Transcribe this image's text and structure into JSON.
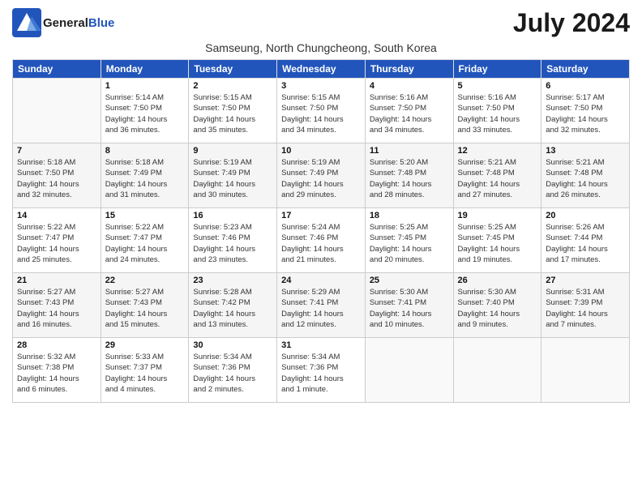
{
  "logo": {
    "general": "General",
    "blue": "Blue"
  },
  "title": "July 2024",
  "subtitle": "Samseung, North Chungcheong, South Korea",
  "days_of_week": [
    "Sunday",
    "Monday",
    "Tuesday",
    "Wednesday",
    "Thursday",
    "Friday",
    "Saturday"
  ],
  "weeks": [
    [
      {
        "day": "",
        "info": ""
      },
      {
        "day": "1",
        "info": "Sunrise: 5:14 AM\nSunset: 7:50 PM\nDaylight: 14 hours\nand 36 minutes."
      },
      {
        "day": "2",
        "info": "Sunrise: 5:15 AM\nSunset: 7:50 PM\nDaylight: 14 hours\nand 35 minutes."
      },
      {
        "day": "3",
        "info": "Sunrise: 5:15 AM\nSunset: 7:50 PM\nDaylight: 14 hours\nand 34 minutes."
      },
      {
        "day": "4",
        "info": "Sunrise: 5:16 AM\nSunset: 7:50 PM\nDaylight: 14 hours\nand 34 minutes."
      },
      {
        "day": "5",
        "info": "Sunrise: 5:16 AM\nSunset: 7:50 PM\nDaylight: 14 hours\nand 33 minutes."
      },
      {
        "day": "6",
        "info": "Sunrise: 5:17 AM\nSunset: 7:50 PM\nDaylight: 14 hours\nand 32 minutes."
      }
    ],
    [
      {
        "day": "7",
        "info": "Sunrise: 5:18 AM\nSunset: 7:50 PM\nDaylight: 14 hours\nand 32 minutes."
      },
      {
        "day": "8",
        "info": "Sunrise: 5:18 AM\nSunset: 7:49 PM\nDaylight: 14 hours\nand 31 minutes."
      },
      {
        "day": "9",
        "info": "Sunrise: 5:19 AM\nSunset: 7:49 PM\nDaylight: 14 hours\nand 30 minutes."
      },
      {
        "day": "10",
        "info": "Sunrise: 5:19 AM\nSunset: 7:49 PM\nDaylight: 14 hours\nand 29 minutes."
      },
      {
        "day": "11",
        "info": "Sunrise: 5:20 AM\nSunset: 7:48 PM\nDaylight: 14 hours\nand 28 minutes."
      },
      {
        "day": "12",
        "info": "Sunrise: 5:21 AM\nSunset: 7:48 PM\nDaylight: 14 hours\nand 27 minutes."
      },
      {
        "day": "13",
        "info": "Sunrise: 5:21 AM\nSunset: 7:48 PM\nDaylight: 14 hours\nand 26 minutes."
      }
    ],
    [
      {
        "day": "14",
        "info": "Sunrise: 5:22 AM\nSunset: 7:47 PM\nDaylight: 14 hours\nand 25 minutes."
      },
      {
        "day": "15",
        "info": "Sunrise: 5:22 AM\nSunset: 7:47 PM\nDaylight: 14 hours\nand 24 minutes."
      },
      {
        "day": "16",
        "info": "Sunrise: 5:23 AM\nSunset: 7:46 PM\nDaylight: 14 hours\nand 23 minutes."
      },
      {
        "day": "17",
        "info": "Sunrise: 5:24 AM\nSunset: 7:46 PM\nDaylight: 14 hours\nand 21 minutes."
      },
      {
        "day": "18",
        "info": "Sunrise: 5:25 AM\nSunset: 7:45 PM\nDaylight: 14 hours\nand 20 minutes."
      },
      {
        "day": "19",
        "info": "Sunrise: 5:25 AM\nSunset: 7:45 PM\nDaylight: 14 hours\nand 19 minutes."
      },
      {
        "day": "20",
        "info": "Sunrise: 5:26 AM\nSunset: 7:44 PM\nDaylight: 14 hours\nand 17 minutes."
      }
    ],
    [
      {
        "day": "21",
        "info": "Sunrise: 5:27 AM\nSunset: 7:43 PM\nDaylight: 14 hours\nand 16 minutes."
      },
      {
        "day": "22",
        "info": "Sunrise: 5:27 AM\nSunset: 7:43 PM\nDaylight: 14 hours\nand 15 minutes."
      },
      {
        "day": "23",
        "info": "Sunrise: 5:28 AM\nSunset: 7:42 PM\nDaylight: 14 hours\nand 13 minutes."
      },
      {
        "day": "24",
        "info": "Sunrise: 5:29 AM\nSunset: 7:41 PM\nDaylight: 14 hours\nand 12 minutes."
      },
      {
        "day": "25",
        "info": "Sunrise: 5:30 AM\nSunset: 7:41 PM\nDaylight: 14 hours\nand 10 minutes."
      },
      {
        "day": "26",
        "info": "Sunrise: 5:30 AM\nSunset: 7:40 PM\nDaylight: 14 hours\nand 9 minutes."
      },
      {
        "day": "27",
        "info": "Sunrise: 5:31 AM\nSunset: 7:39 PM\nDaylight: 14 hours\nand 7 minutes."
      }
    ],
    [
      {
        "day": "28",
        "info": "Sunrise: 5:32 AM\nSunset: 7:38 PM\nDaylight: 14 hours\nand 6 minutes."
      },
      {
        "day": "29",
        "info": "Sunrise: 5:33 AM\nSunset: 7:37 PM\nDaylight: 14 hours\nand 4 minutes."
      },
      {
        "day": "30",
        "info": "Sunrise: 5:34 AM\nSunset: 7:36 PM\nDaylight: 14 hours\nand 2 minutes."
      },
      {
        "day": "31",
        "info": "Sunrise: 5:34 AM\nSunset: 7:36 PM\nDaylight: 14 hours\nand 1 minute."
      },
      {
        "day": "",
        "info": ""
      },
      {
        "day": "",
        "info": ""
      },
      {
        "day": "",
        "info": ""
      }
    ]
  ]
}
